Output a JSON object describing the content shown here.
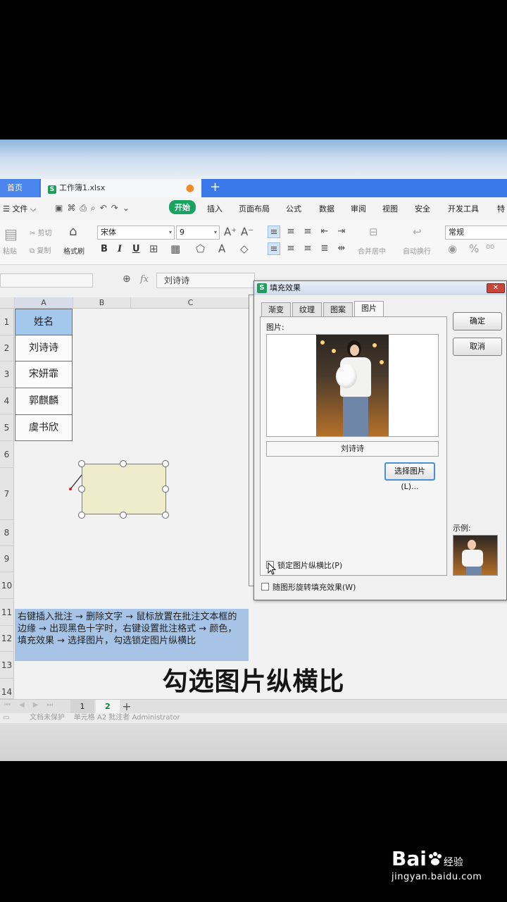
{
  "tabs": {
    "home": "首页",
    "document": "工作簿1.xlsx",
    "new_tab": "+"
  },
  "menu": {
    "file": "文件",
    "items": [
      "开始",
      "插入",
      "页面布局",
      "公式",
      "数据",
      "审阅",
      "视图",
      "安全",
      "开发工具",
      "特"
    ]
  },
  "ribbon": {
    "paste": "粘贴",
    "cut": "剪切",
    "copy": "复制",
    "format_painter": "格式刷",
    "font_name": "宋体",
    "font_size": "9",
    "merge_center": "合并居中",
    "wrap_text": "自动换行",
    "number_format": "常规"
  },
  "formula_bar": {
    "fx": "fx",
    "value": "刘诗诗"
  },
  "grid": {
    "columns": [
      "A",
      "B",
      "C"
    ],
    "rows": [
      "1",
      "2",
      "3",
      "4",
      "5",
      "6",
      "7",
      "8",
      "9",
      "10",
      "11",
      "12",
      "13",
      "14"
    ],
    "names": [
      "姓名",
      "刘诗诗",
      "宋妍霏",
      "郭麒麟",
      "虞书欣"
    ],
    "note": "右键插入批注 → 删除文字 → 鼠标放置在批注文本框的边缘 → 出现黑色十字时，右键设置批注格式 → 颜色，填充效果 → 选择图片，勾选锁定图片纵横比"
  },
  "sheets": {
    "tabs": [
      "1",
      "2"
    ],
    "active": "2",
    "add": "+"
  },
  "statusbar": {
    "text": "文档未保护    单元格 A2 批注者 Administrator"
  },
  "dialog": {
    "title": "填充效果",
    "tabs": [
      "渐变",
      "纹理",
      "图案",
      "图片"
    ],
    "active_tab": "图片",
    "picture_label": "图片:",
    "picture_name": "刘诗诗",
    "select_picture": "选择图片(L)...",
    "ok": "确定",
    "cancel": "取消",
    "sample_label": "示例:",
    "lock_aspect": "锁定图片纵横比(P)",
    "rotate_with_shape": "随图形旋转填充效果(W)"
  },
  "subtitle": "勾选图片纵横比",
  "watermark": {
    "brand": "Bai",
    "brand2": "经验",
    "url": "jingyan.baidu.com"
  },
  "colors": {
    "accent_green": "#1aa260",
    "tab_blue": "#3b78e7",
    "header_cell": "#a3c7ed",
    "note_fill": "#a7c4e6",
    "comment_fill": "#efeccc"
  }
}
